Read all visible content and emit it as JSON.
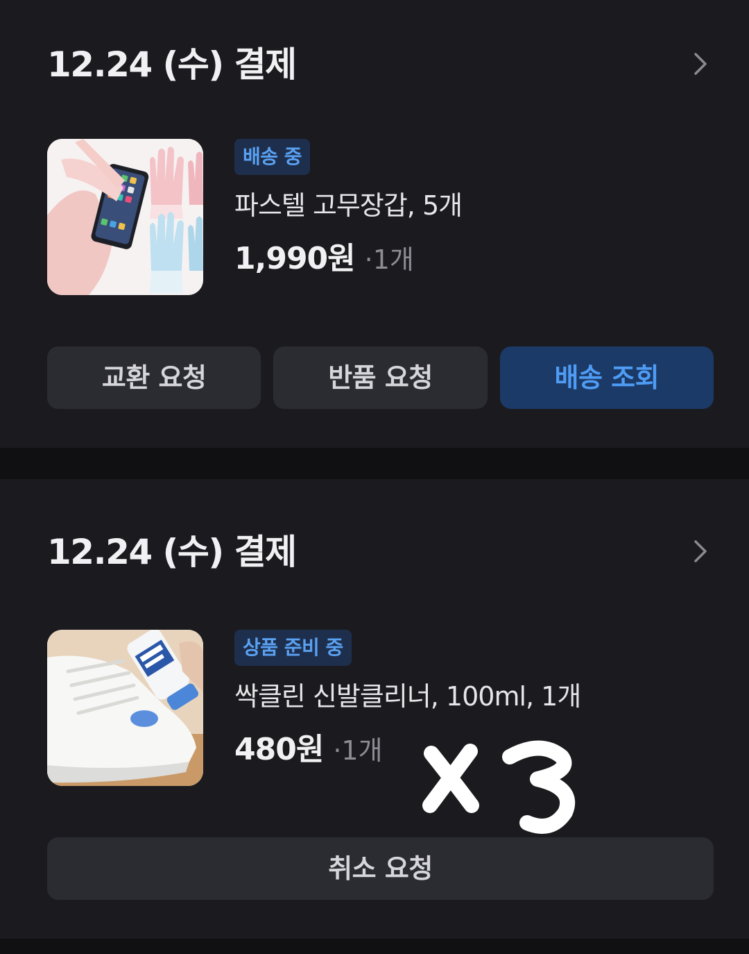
{
  "orders": [
    {
      "date_label": "12.24 (수) 결제",
      "status": "배송 중",
      "product_name": "파스텔 고무장갑, 5개",
      "price": "1,990원",
      "qty": "·1개",
      "buttons": [
        "교환 요청",
        "반품 요청",
        "배송 조회"
      ]
    },
    {
      "date_label": "12.24 (수) 결제",
      "status": "상품 준비 중",
      "product_name": "싹클린 신발클리너, 100ml, 1개",
      "price": "480원",
      "qty": "·1개",
      "buttons": [
        "취소 요청"
      ]
    }
  ],
  "annotation": "x3",
  "colors": {
    "background": "#1b1b1f",
    "badge_bg": "#1e2f4d",
    "badge_text": "#5aa1f2",
    "primary_button_bg": "#1b3a67",
    "primary_button_text": "#4f9cf5",
    "button_bg": "#2b2c31"
  },
  "icons": [
    "chevron-right-icon"
  ]
}
